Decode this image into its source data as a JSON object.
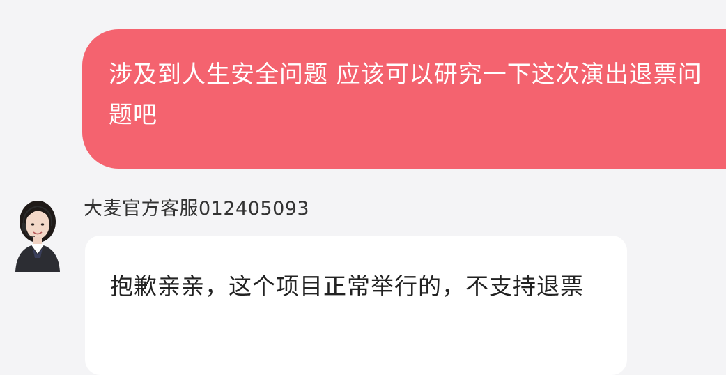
{
  "conversation": {
    "outgoing": {
      "text": "涉及到人生安全问题 应该可以研究一下这次演出退票问题吧"
    },
    "incoming": {
      "sender_name": "大麦官方客服012405093",
      "avatar": "customer-service-agent-avatar",
      "text": "抱歉亲亲，这个项目正常举行的，不支持退票"
    }
  },
  "colors": {
    "outgoing_bubble": "#f4636f",
    "incoming_bubble": "#ffffff",
    "background": "#f4f4f6"
  }
}
